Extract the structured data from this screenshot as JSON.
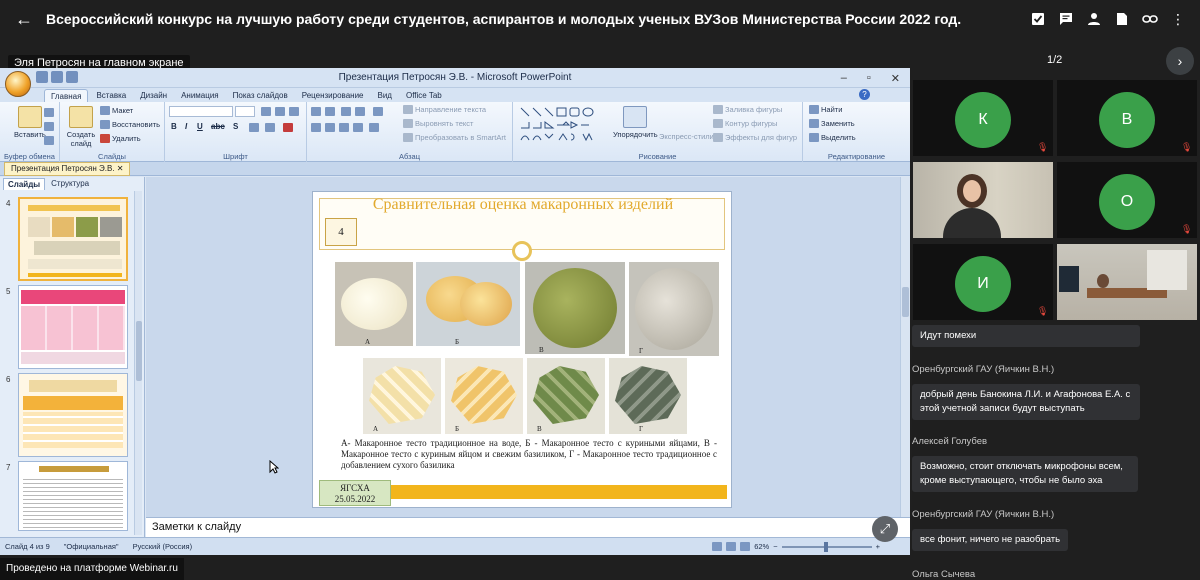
{
  "header": {
    "title": "Всероссийский конкурс на лучшую работу среди студентов, аспирантов и молодых ученых ВУЗов Министерства России 2022 год.",
    "icons": [
      "arrow-left-icon",
      "checkbox-icon",
      "chat-icon",
      "person-icon",
      "file-icon",
      "link-icon",
      "more-vert-icon"
    ]
  },
  "presenter_label": "Эля Петросян на главном экране",
  "pager": {
    "label": "1/2"
  },
  "ppt": {
    "window_title": "Презентация Петросян Э.В. - Microsoft PowerPoint",
    "tabs": [
      "Главная",
      "Вставка",
      "Дизайн",
      "Анимация",
      "Показ слайдов",
      "Рецензирование",
      "Вид",
      "Office Tab"
    ],
    "groups": {
      "clipboard": {
        "label": "Буфер обмена",
        "paste": "Вставить"
      },
      "slides": {
        "label": "Слайды",
        "create": "Создать слайд",
        "layout": "Макет",
        "reset": "Восстановить",
        "delete": "Удалить"
      },
      "font": {
        "label": "Шрифт"
      },
      "paragraph": {
        "label": "Абзац",
        "text_direction": "Направление текста",
        "align_text": "Выровнять текст",
        "smartart": "Преобразовать в SmartArt"
      },
      "drawing": {
        "label": "Рисование",
        "arrange": "Упорядочить",
        "quick_styles": "Экспресс-стили",
        "fill": "Заливка фигуры",
        "outline": "Контур фигуры",
        "effects": "Эффекты для фигур"
      },
      "editing": {
        "label": "Редактирование",
        "find": "Найти",
        "replace": "Заменить",
        "select": "Выделить"
      }
    },
    "doc_tab": "Презентация Петросян Э.В.",
    "pane_tabs": [
      "Слайды",
      "Структура"
    ],
    "thumb_numbers": [
      "4",
      "5",
      "6",
      "7"
    ],
    "slide": {
      "title": "Сравнительная оценка макаронных изделий",
      "number": "4",
      "photo_labels_top": [
        "А",
        "Б",
        "В",
        "Г"
      ],
      "photo_labels_bottom": [
        "А",
        "Б",
        "В",
        "Г"
      ],
      "caption": "А- Макаронное тесто традиционное на воде, Б - Макаронное тесто с куриными яйцами, В - Макаронное тесто с куриным яйцом и свежим базиликом, Г - Макаронное тесто традиционное с добавлением сухого базилика",
      "badge_line1": "ЯГСХА",
      "badge_line2": "25.05.2022"
    },
    "notes_placeholder": "Заметки к слайду",
    "status": {
      "slide": "Слайд 4 из 9",
      "theme": "\"Официальная\"",
      "lang": "Русский (Россия)",
      "zoom": "62%"
    }
  },
  "participants": [
    {
      "initial": "К",
      "color": "#3aa04a"
    },
    {
      "initial": "В",
      "color": "#3aa04a"
    },
    {
      "initial": "",
      "video": true
    },
    {
      "initial": "О",
      "color": "#3aa04a"
    },
    {
      "initial": "И",
      "color": "#3aa04a"
    },
    {
      "initial": "",
      "video": true
    }
  ],
  "chat": [
    {
      "author": "",
      "text": "Идут помехи"
    },
    {
      "author": "Оренбургский ГАУ (Яичкин В.Н.)",
      "text": "добрый день Банокина Л.И. и Агафонова Е.А. с этой учетной записи будут выступать"
    },
    {
      "author": "Алексей Голубев",
      "text": "Возможно, стоит отключать микрофоны всем, кроме выступающего, чтобы не было эха"
    },
    {
      "author": "Оренбургский ГАУ (Яичкин В.Н.)",
      "text": "все фонит, ничего не разобрать"
    },
    {
      "author": "Ольга Сычева",
      "text": ""
    }
  ],
  "footer_label": "Проведено на платформе Webinar.ru"
}
